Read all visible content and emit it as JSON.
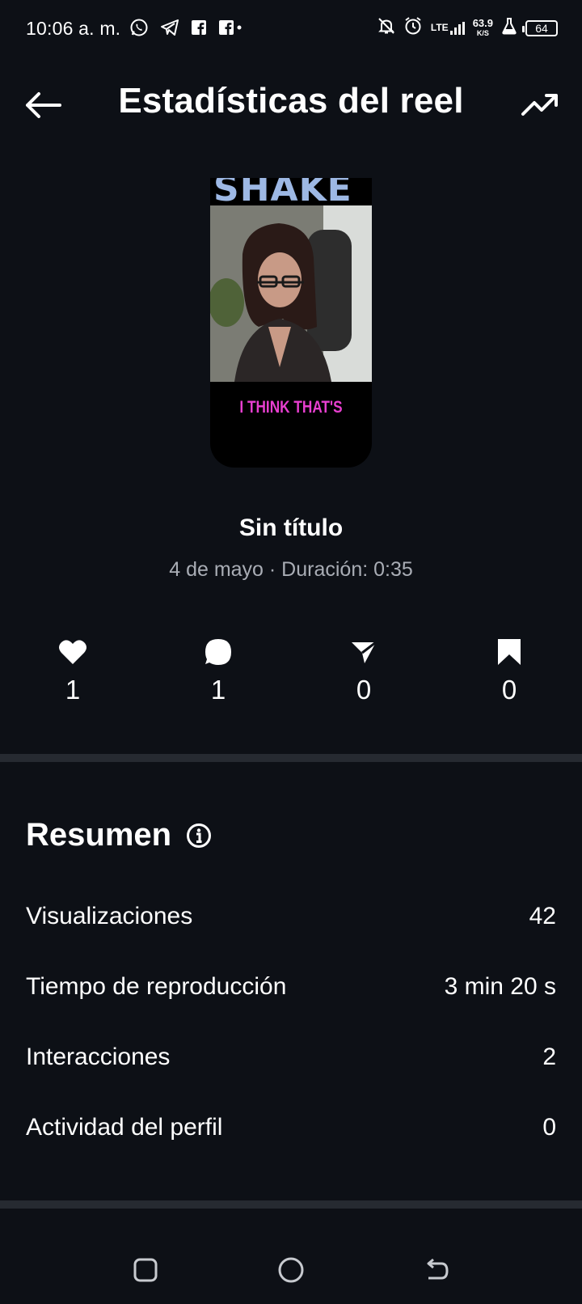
{
  "status_bar": {
    "time": "10:06 a. m.",
    "network_label": "LTE",
    "speed_value": "63.9",
    "speed_unit": "K/S",
    "battery": "64"
  },
  "header": {
    "title": "Estadísticas del reel",
    "back_icon": "arrow-left-icon",
    "trend_icon": "trending-up-icon"
  },
  "thumbnail": {
    "top_text": "SHAKE",
    "caption": "I THINK THAT'S"
  },
  "reel": {
    "title": "Sin título",
    "meta": "4 de mayo · Duración: 0:35"
  },
  "engagement": {
    "likes": "1",
    "comments": "1",
    "shares": "0",
    "saves": "0"
  },
  "summary": {
    "heading": "Resumen",
    "rows": [
      {
        "label": "Visualizaciones",
        "value": "42"
      },
      {
        "label": "Tiempo de reproducción",
        "value": "3 min 20 s"
      },
      {
        "label": "Interacciones",
        "value": "2"
      },
      {
        "label": "Actividad del perfil",
        "value": "0"
      }
    ]
  },
  "colors": {
    "background": "#0d1016",
    "divider": "#262a31",
    "muted_text": "#a9adb5",
    "caption_pink": "#e83fd0"
  }
}
